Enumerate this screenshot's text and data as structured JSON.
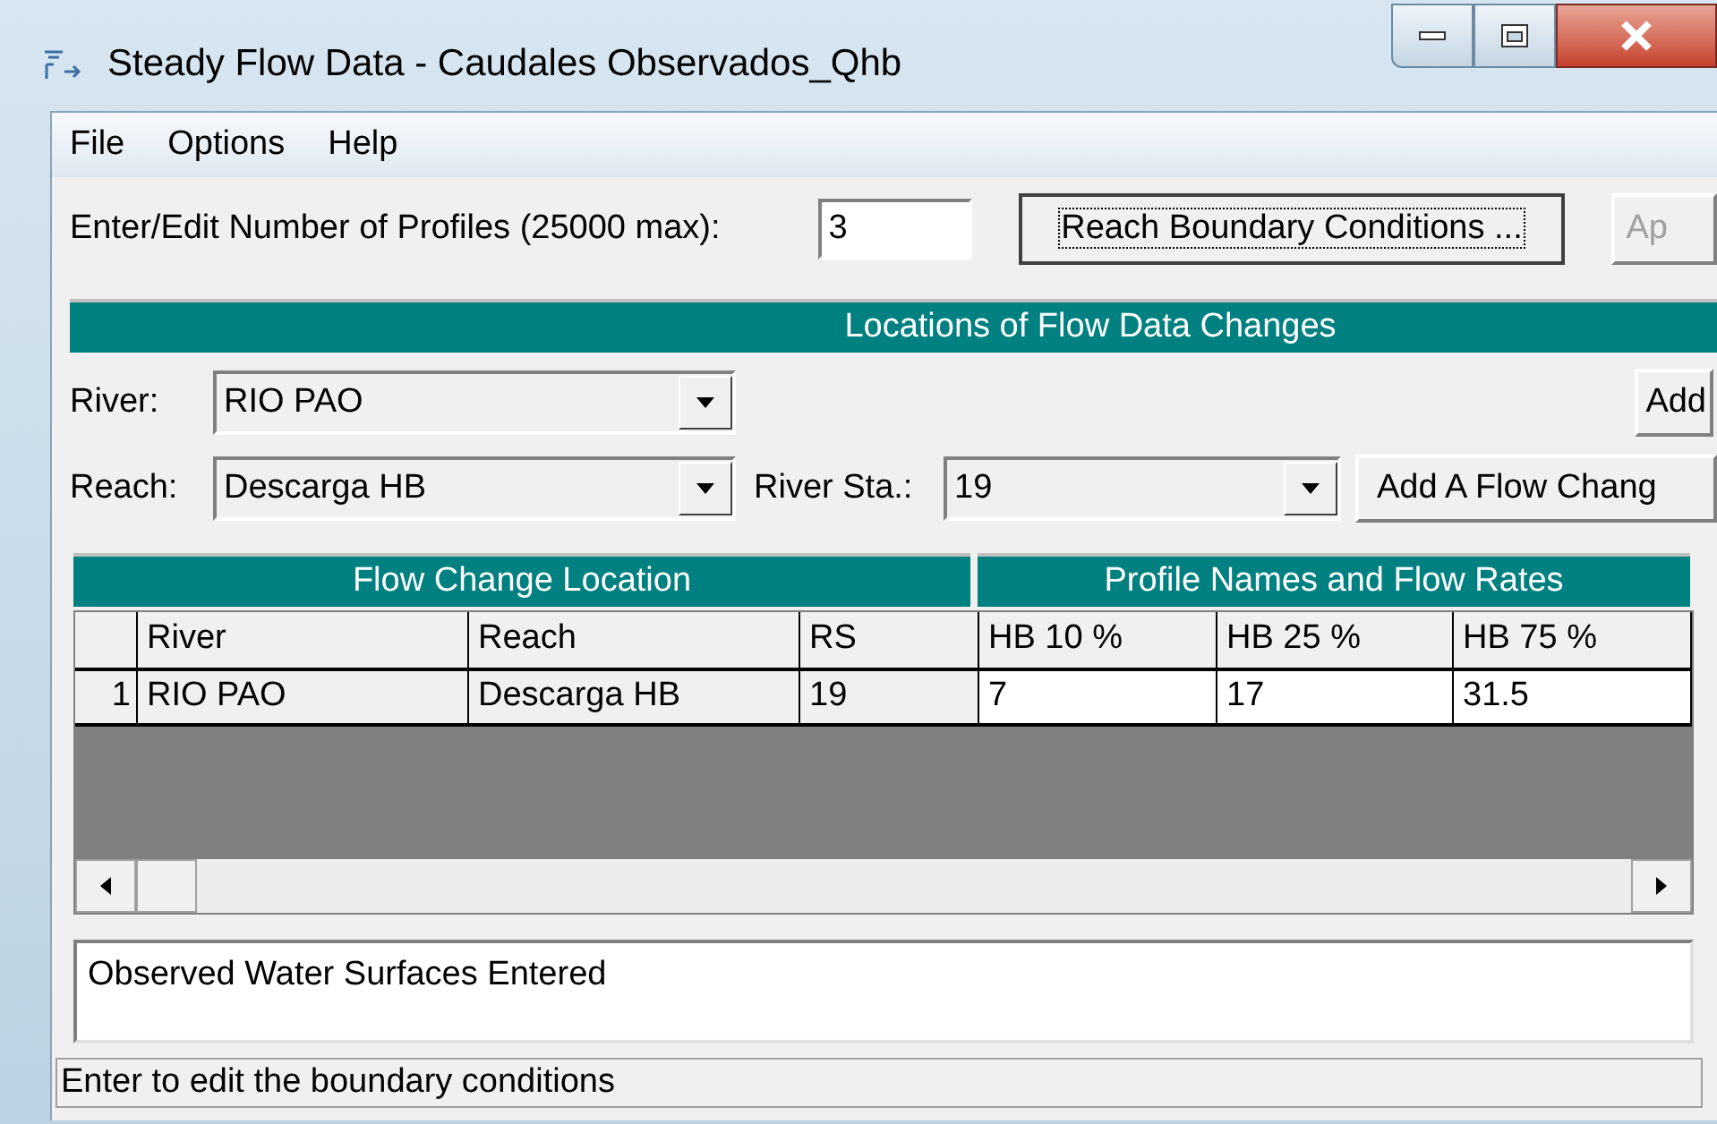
{
  "window": {
    "title": "Steady Flow Data - Caudales Observados_Qhb"
  },
  "menu": [
    "File",
    "Options",
    "Help"
  ],
  "profiles": {
    "label": "Enter/Edit Number of Profiles (25000 max):",
    "value": "3"
  },
  "top_buttons": [
    {
      "label": "Reach Boundary Conditions ...",
      "focused": true,
      "disabled": false
    },
    {
      "label": "Ap",
      "focused": false,
      "disabled": true
    }
  ],
  "locations": {
    "title": "Locations of Flow Data Changes",
    "river": {
      "label": "River:",
      "value": "RIO PAO"
    },
    "add_button": "Add",
    "reach": {
      "label": "Reach:",
      "value": "Descarga HB"
    },
    "river_sta": {
      "label": "River Sta.:",
      "value": "19"
    },
    "add_flow_button": "Add A Flow Chang"
  },
  "table": {
    "groups": [
      "Flow Change Location",
      "Profile Names and Flow Rates"
    ],
    "columns": [
      "River",
      "Reach",
      "RS",
      "HB 10 %",
      "HB 25 %",
      "HB 75 %"
    ],
    "rows": [
      {
        "number": "1",
        "cells": [
          "RIO PAO",
          "Descarga HB",
          "19",
          "7",
          "17",
          "31.5"
        ]
      }
    ]
  },
  "message": "Observed Water Surfaces Entered",
  "status_bar": "Enter to edit the boundary conditions"
}
